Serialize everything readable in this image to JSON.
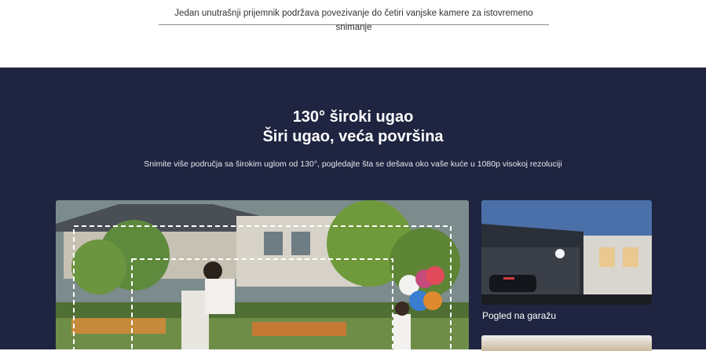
{
  "top_caption": "Jedan unutrašnji prijemnik podržava povezivanje do četiri vanjske kamere za istovremeno snimanje",
  "section": {
    "title_line1": "130° široki ugao",
    "title_line2": "Širi ugao, veća površina",
    "subtitle": "Snimite više područja sa širokim uglom od 130°, pogledajte šta se dešava oko vaše kuće u 1080p visokoj rezoluciji"
  },
  "side_image": {
    "label": "Pogled na garažu"
  },
  "colors": {
    "dark_bg": "#1f2540",
    "text_light": "#ffffff"
  }
}
